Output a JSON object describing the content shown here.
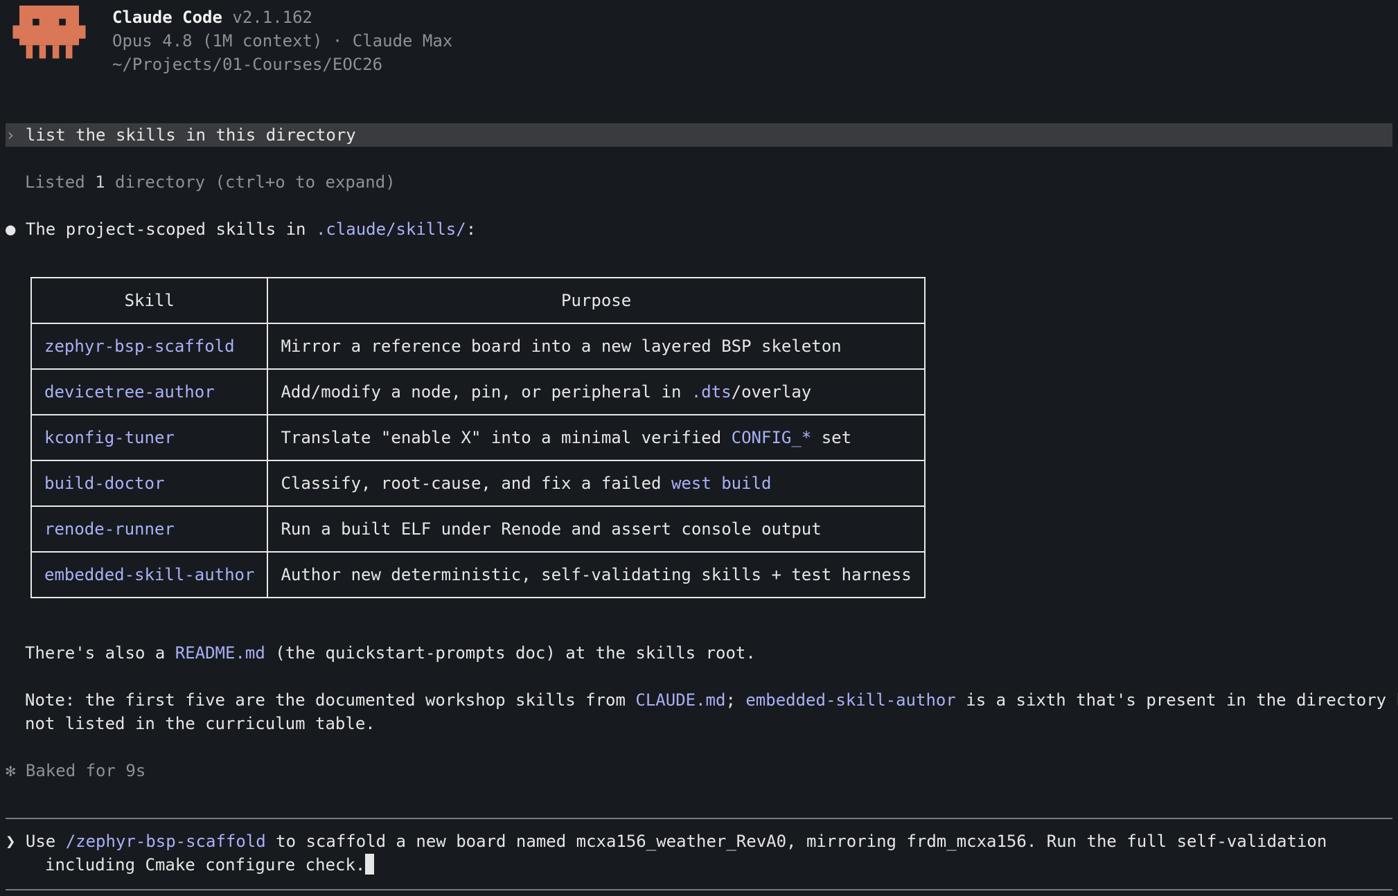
{
  "header": {
    "app_name": "Claude Code",
    "version": "v2.1.162",
    "model_line": "Opus 4.8 (1M context) · Claude Max",
    "cwd": "~/Projects/01-Courses/EOC26",
    "mascot_icon": "claude-pixel-mascot-icon",
    "mascot_color": "#d97757"
  },
  "conversation": {
    "user_prompt_chevron": "›",
    "user_prompt": "list the skills in this directory",
    "tool_status": {
      "prefix": "Listed ",
      "count": "1",
      "suffix": " directory (ctrl+o to expand)"
    },
    "response_bullet": "●",
    "response_intro": {
      "text": "The project-scoped skills in ",
      "path": ".claude/skills/",
      "end": ":"
    },
    "table": {
      "headers": [
        "Skill",
        "Purpose"
      ],
      "rows": [
        {
          "skill": "zephyr-bsp-scaffold",
          "purpose": [
            "Mirror a reference board into a new layered BSP skeleton"
          ]
        },
        {
          "skill": "devicetree-author",
          "purpose": [
            "Add/modify a node, pin, or peripheral in ",
            ".dts",
            "/overlay"
          ]
        },
        {
          "skill": "kconfig-tuner",
          "purpose": [
            "Translate \"enable X\" into a minimal verified ",
            "CONFIG_*",
            " set"
          ]
        },
        {
          "skill": "build-doctor",
          "purpose": [
            "Classify, root-cause, and fix a failed ",
            "west build",
            ""
          ]
        },
        {
          "skill": "renode-runner",
          "purpose": [
            "Run a built ELF under Renode and assert console output"
          ]
        },
        {
          "skill": "embedded-skill-author",
          "purpose": [
            "Author new deterministic, self-validating skills + test harness"
          ]
        }
      ]
    },
    "readme_line": {
      "a": "There's also a ",
      "link": "README.md",
      "b": " (the quickstart-prompts doc) at the skills root."
    },
    "note": {
      "a": "Note: the first five are the documented workshop skills from ",
      "link1": "CLAUDE.md",
      "b": "; ",
      "link2": "embedded-skill-author",
      "c": " is a sixth that's present in the directory but",
      "line2": "not listed in the curriculum table."
    },
    "timing_icon": "✻",
    "timing": "Baked for 9s"
  },
  "input": {
    "chevron": "❯",
    "a": "Use ",
    "command": "/zephyr-bsp-scaffold",
    "b": " to scaffold a new board named mcxa156_weather_RevA0, mirroring frdm_mcxa156. Run the full self-validation",
    "line2": "including Cmake configure check."
  },
  "colors": {
    "background": "#171a1f",
    "text": "#e6e6e6",
    "dim": "#8d9096",
    "link": "#a9b1f5",
    "prompt_highlight": "#3a3b3e"
  }
}
